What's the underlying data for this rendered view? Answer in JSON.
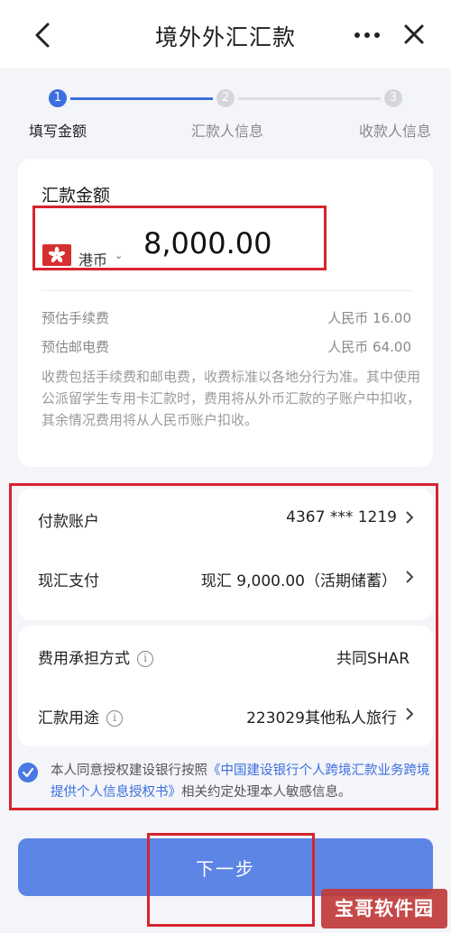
{
  "header": {
    "title": "境外外汇汇款"
  },
  "stepper": {
    "steps": [
      {
        "number": "1",
        "label": "填写金额"
      },
      {
        "number": "2",
        "label": "汇款人信息"
      },
      {
        "number": "3",
        "label": "收款人信息"
      }
    ],
    "current_step": 1
  },
  "amount": {
    "title": "汇款金额",
    "currency": "港币",
    "value": "8,000.00",
    "fees": [
      {
        "label": "预估手续费",
        "value": "人民币 16.00"
      },
      {
        "label": "预估邮电费",
        "value": "人民币 64.00"
      }
    ],
    "note": "收费包括手续费和邮电费，收费标准以各地分行为准。其中使用公派留学生专用卡汇款时，费用将从外币汇款的子账户中扣收，其余情况费用将从人民币账户扣收。"
  },
  "payment": {
    "account_label": "付款账户",
    "account_value": "4367 *** 1219",
    "method_label": "现汇支付",
    "method_value": "现汇  9,000.00（活期储蓄）"
  },
  "fee_options": {
    "bearer_label": "费用承担方式",
    "bearer_value": "共同SHAR",
    "purpose_label": "汇款用途",
    "purpose_value": "223029其他私人旅行"
  },
  "consent": {
    "prefix": "本人同意授权建设银行按照",
    "link": "《中国建设银行个人跨境汇款业务跨境提供个人信息授权书》",
    "suffix": "相关约定处理本人敏感信息。",
    "checked": true
  },
  "next_button": "下一步",
  "watermark": "宝哥软件园",
  "colors": {
    "accent": "#3c6ee0",
    "button": "#5c85e6",
    "highlight": "#d6242d"
  },
  "icons": [
    "back-icon",
    "more-icon",
    "close-icon",
    "hk-flag-icon",
    "chevron-down-icon",
    "chevron-right-icon",
    "info-icon",
    "check-icon"
  ]
}
